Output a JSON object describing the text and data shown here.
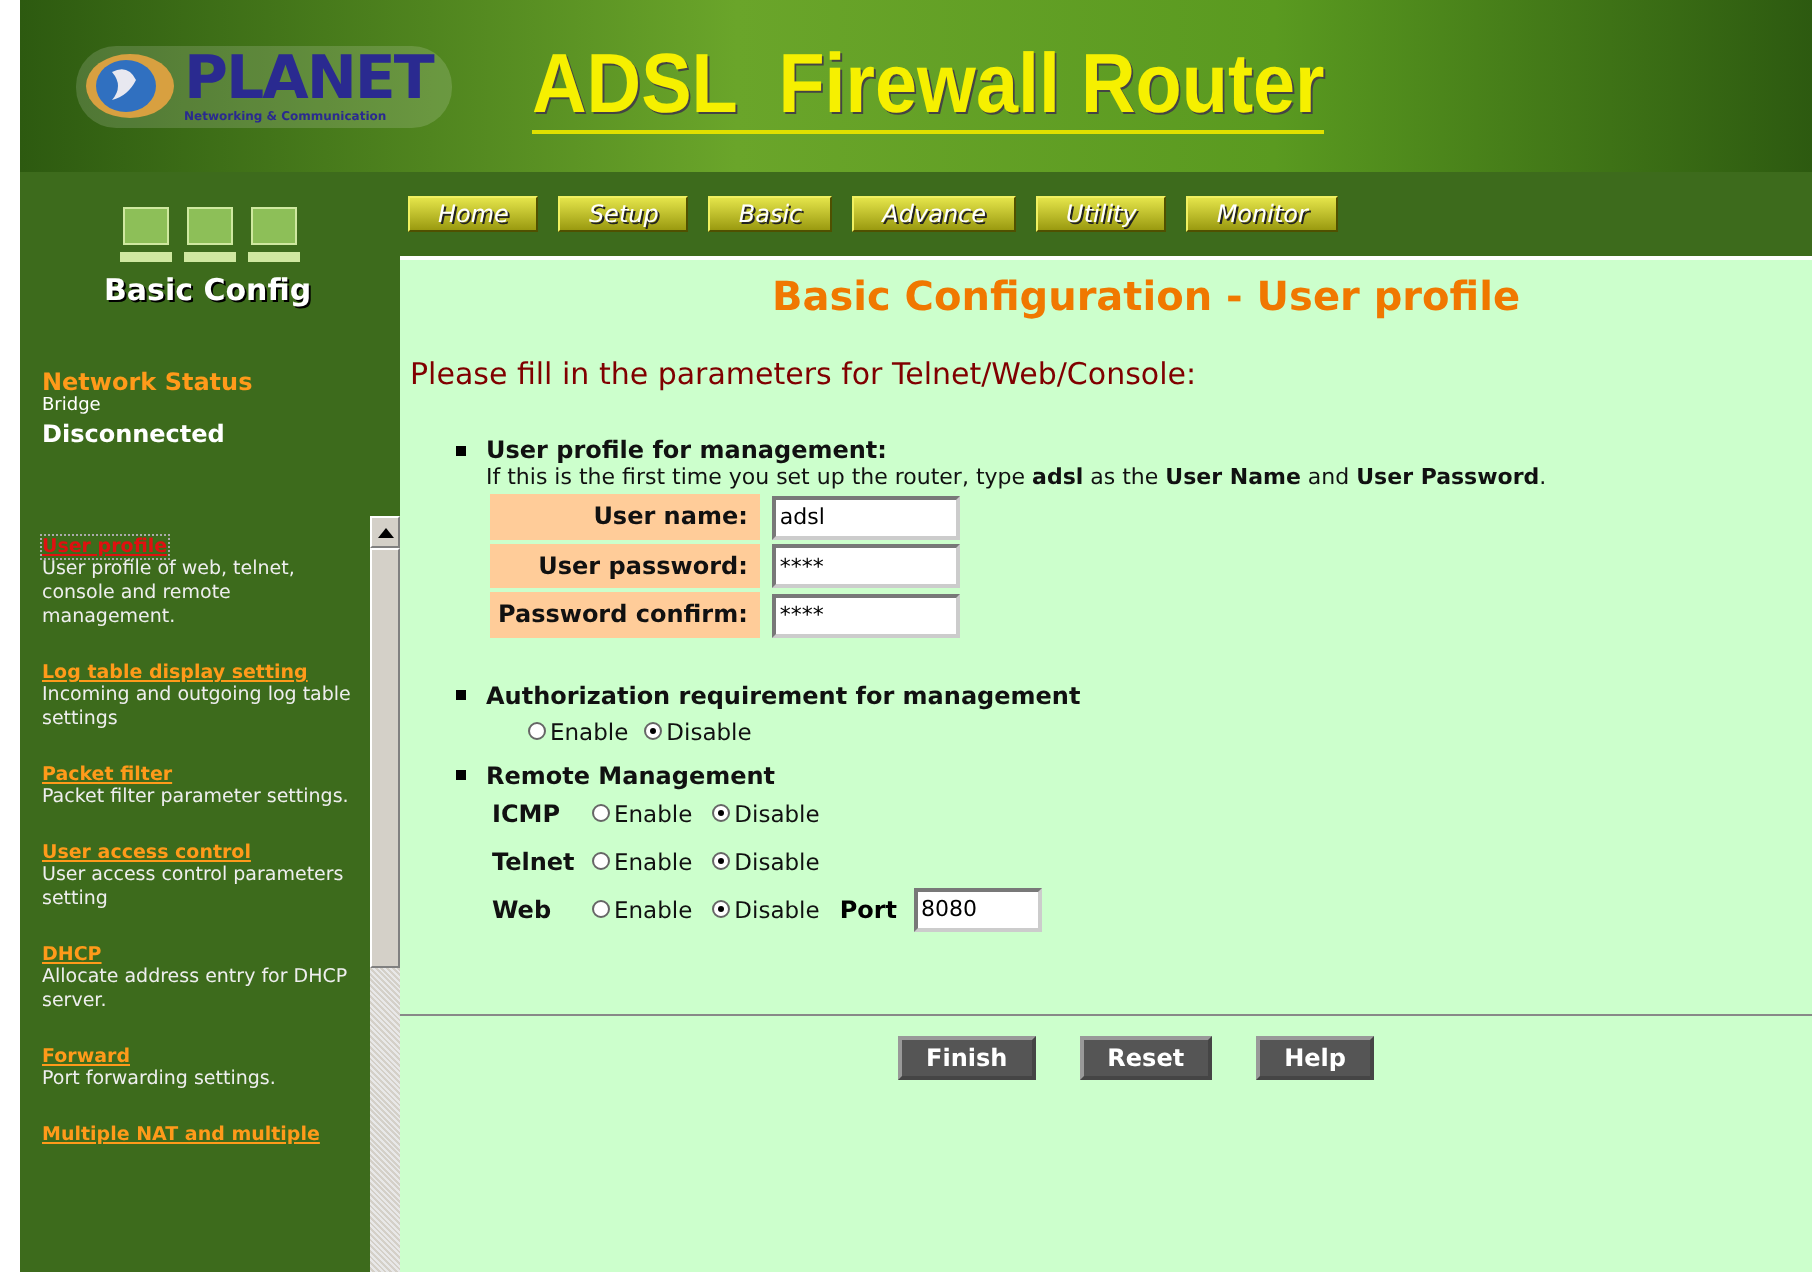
{
  "header": {
    "logo_name": "PLANET",
    "logo_tagline": "Networking & Communication",
    "title": "ADSL  Firewall Router"
  },
  "nav": [
    {
      "label": "Home",
      "selected": false
    },
    {
      "label": "Setup",
      "selected": false
    },
    {
      "label": "Basic",
      "selected": false
    },
    {
      "label": "Advance",
      "selected": false
    },
    {
      "label": "Utility",
      "selected": false
    },
    {
      "label": "Monitor",
      "selected": false
    }
  ],
  "sidebar": {
    "heading": "Basic Config",
    "status_title": "Network Status",
    "status_mode": "Bridge",
    "status_value": "Disconnected",
    "items": [
      {
        "title": "User profile",
        "description": "User profile of web, telnet, console and remote management.",
        "selected": true
      },
      {
        "title": "Log table display setting",
        "description": "Incoming and outgoing log table settings",
        "selected": false
      },
      {
        "title": "Packet filter",
        "description": "Packet filter parameter settings.",
        "selected": false
      },
      {
        "title": "User access control",
        "description": "User access control parameters setting",
        "selected": false
      },
      {
        "title": "DHCP",
        "description": "Allocate address entry for DHCP server.",
        "selected": false
      },
      {
        "title": "Forward",
        "description": "Port forwarding settings.",
        "selected": false
      },
      {
        "title": "Multiple NAT and multiple",
        "selected": false
      }
    ]
  },
  "page": {
    "title": "Basic Configuration - User profile",
    "intro": "Please fill in the parameters for Telnet/Web/Console:",
    "profile": {
      "heading": "User profile for management:",
      "hint": "If this is the first time you set up the router, type **adsl** as the **User Name** and **User Password**.",
      "fields": [
        {
          "label": "User name:",
          "value": "adsl"
        },
        {
          "label": "User password:",
          "value": "****"
        },
        {
          "label": "Password confirm:",
          "value": "****"
        }
      ]
    },
    "authorization": {
      "heading": "Authorization requirement for management",
      "options": [
        {
          "label": "Enable",
          "selected": false
        },
        {
          "label": "Disable",
          "selected": true
        }
      ]
    },
    "remote": {
      "heading": "Remote Management",
      "rows": [
        {
          "label": "ICMP",
          "options": [
            {
              "label": "Enable",
              "selected": false
            },
            {
              "label": "Disable",
              "selected": true
            }
          ]
        },
        {
          "label": "Telnet",
          "options": [
            {
              "label": "Enable",
              "selected": false
            },
            {
              "label": "Disable",
              "selected": true
            }
          ]
        },
        {
          "label": "Web",
          "options": [
            {
              "label": "Enable",
              "selected": false
            },
            {
              "label": "Disable",
              "selected": true
            }
          ],
          "port_label": "Port",
          "port_value": "8080"
        }
      ]
    },
    "buttons": [
      "Finish",
      "Reset",
      "Help"
    ]
  }
}
